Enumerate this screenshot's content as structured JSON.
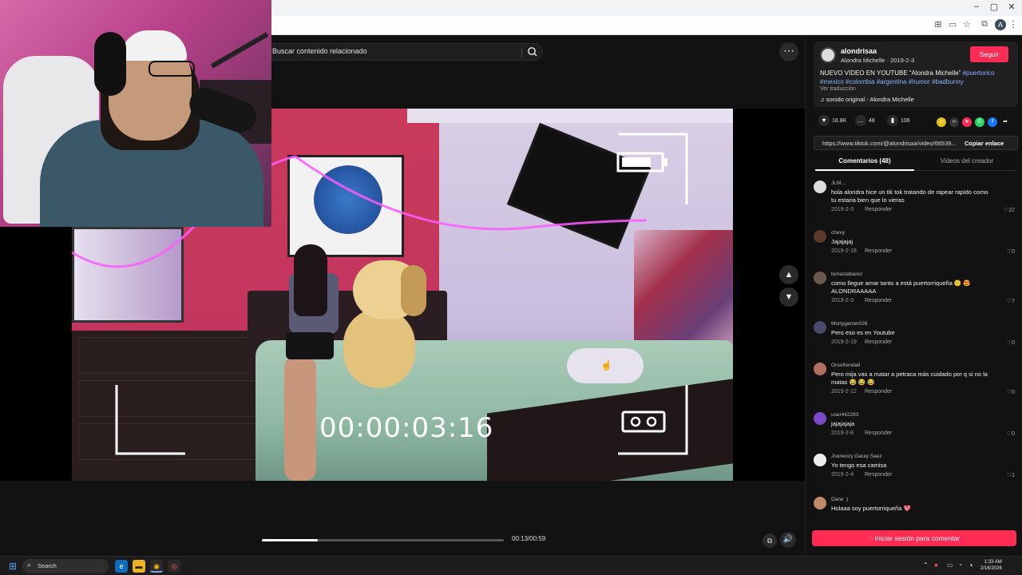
{
  "browser": {
    "window_controls": [
      "–",
      "▢",
      "✕"
    ],
    "toolbar_icons": [
      "translate-icon",
      "cast-icon",
      "star-icon",
      "extensions-icon",
      "profile-avatar",
      "menu-icon"
    ],
    "profile_initial": "A"
  },
  "search": {
    "text": "Buscar contenido relacionado"
  },
  "video": {
    "timecode": "00:00:03:16",
    "progress_fraction": 0.23,
    "time_readout": "00:13/00:59"
  },
  "author": {
    "username": "alondrisaa",
    "subtitle": "Alondra Michelle · 2019-2-3",
    "follow_label": "Seguir",
    "desc_text": "NUEVO VIDEO EN YOUTUBE “Alondra Michelle” ",
    "desc_tags": "#puertorico #mexico #colombia #argentina #humor #badbunny",
    "see_translation": "Ver traducción",
    "sound": "sonido original - Alondra Michelle"
  },
  "actions": {
    "likes": "18.8K",
    "comments": "48",
    "saves": "106"
  },
  "link": {
    "url": "https://www.tiktok.com/@alondrisaa/video/66539...",
    "copy_label": "Copiar enlace"
  },
  "tabs": {
    "comments": "Comentarios (48)",
    "creator": "Videos del creador"
  },
  "comments": [
    {
      "user": "JLM...",
      "text": "hola alondra hice un tik tok tratando de rapear rapido como tu estaria bien que lo vieras",
      "date": "2019-2-3",
      "likes": "22",
      "avatar": "#dcdcdc"
    },
    {
      "user": "chevy",
      "text": "Jajajajaj",
      "date": "2019-2-16",
      "likes": "0",
      "avatar": "#5a3a2a"
    },
    {
      "user": "tomastabarez",
      "text": "como llegue amar tanto a está puertorriqueña 🙂 😍 ALONDRAAAAA",
      "date": "2019-2-3",
      "likes": "7",
      "avatar": "#6a5a4a"
    },
    {
      "user": "Mortygamer026",
      "text": "Pero eso es en Youtube",
      "date": "2019-2-19",
      "likes": "0",
      "avatar": "#4a4a6a"
    },
    {
      "user": "OreoKendall",
      "text": "Pero mija vas a matar a petraca más cuidado por q si no la matas 😂 😂 😂",
      "date": "2019-2-12",
      "likes": "0",
      "avatar": "#b07060"
    },
    {
      "user": "user442293",
      "text": "jajajajaja",
      "date": "2019-2-8",
      "likes": "0",
      "avatar": "#7a4ac9"
    },
    {
      "user": "Joanexzy Garay Saez",
      "text": "Yo tengo esa camisa",
      "date": "2019-2-4",
      "likes": "1",
      "avatar": "#eeeeee"
    },
    {
      "user": "Dane :)",
      "text": "Holaaa soy puertorriqueña 💖",
      "date": "",
      "likes": "",
      "avatar": "#c08a6a"
    }
  ],
  "comment_meta": {
    "reply_label": "Responder"
  },
  "login": {
    "label": "Iniciar sesión para comentar"
  },
  "taskbar": {
    "search_label": "Search",
    "time": "1:33 AM",
    "date": "2/16/2026"
  },
  "colors": {
    "accent": "#fe2c55",
    "tag": "#8ab4ff",
    "bg": "#121212"
  }
}
